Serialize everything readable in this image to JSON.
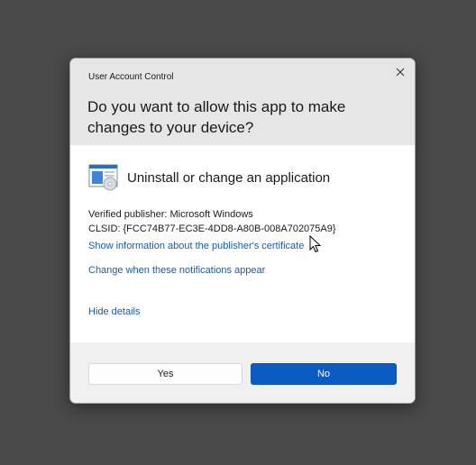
{
  "dialog": {
    "header_title": "User Account Control",
    "question": "Do you want to allow this app to make changes to your device?",
    "close_icon": "close-icon"
  },
  "app": {
    "name": "Uninstall or change an application",
    "icon": "programs-icon"
  },
  "details": {
    "publisher": "Verified publisher: Microsoft Windows",
    "clsid": "CLSID: {FCC74B77-EC3E-4DD8-A80B-008A702075A9}"
  },
  "links": {
    "publisher_info": "Show information about the publisher's certificate",
    "notifications": "Change when these notifications appear",
    "hide_details": "Hide details"
  },
  "buttons": {
    "yes": "Yes",
    "no": "No"
  },
  "colors": {
    "accent": "#0a5cc2",
    "link": "#1a5aa6",
    "backdrop": "#4a4a4a"
  }
}
